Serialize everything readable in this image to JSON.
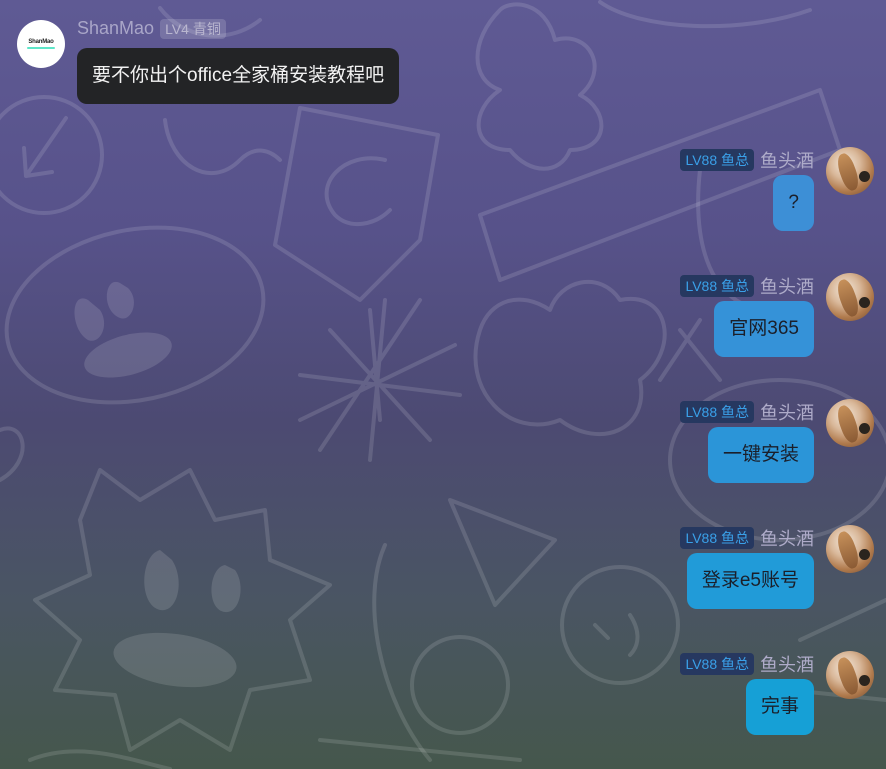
{
  "left_message": {
    "username": "ShanMao",
    "badge": "LV4 青铜",
    "avatar_logo": "ShanMao",
    "text": "要不你出个office全家桶安装教程吧"
  },
  "right_user": {
    "username": "鱼头酒",
    "badge": "LV88 鱼总"
  },
  "right_messages": [
    {
      "text": "?",
      "bubble_color": "#3d8fd6"
    },
    {
      "text": "官网365",
      "bubble_color": "#3592d8"
    },
    {
      "text": "一键安装",
      "bubble_color": "#2b95d8"
    },
    {
      "text": "登录e5账号",
      "bubble_color": "#219bd8"
    },
    {
      "text": "完事",
      "bubble_color": "#16a0d6"
    }
  ]
}
